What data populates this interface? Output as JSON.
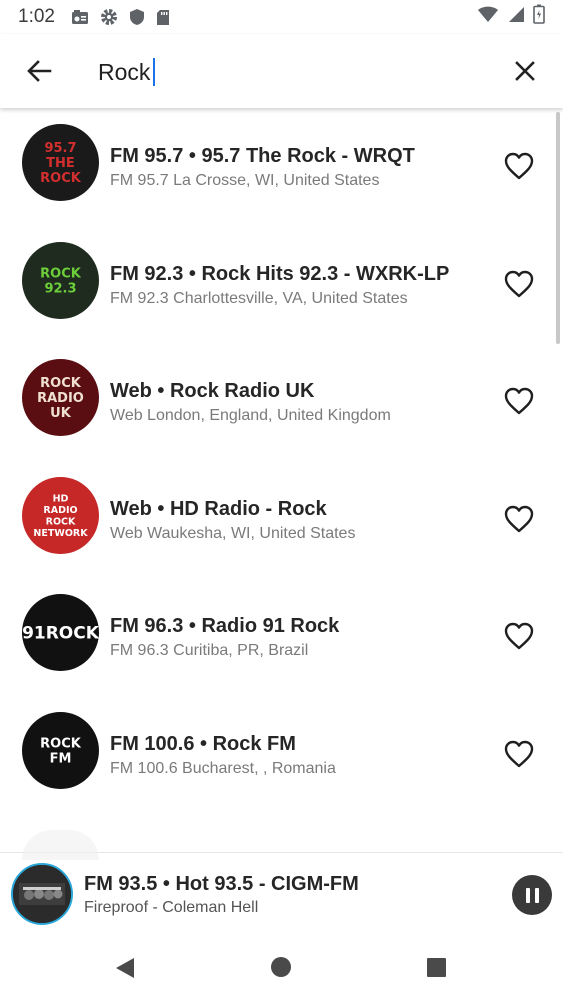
{
  "status_bar": {
    "time": "1:02",
    "icons": [
      "media-icon",
      "gear-icon",
      "shield-icon",
      "sd-card-icon"
    ],
    "right_icons": [
      "wifi-icon",
      "signal-icon",
      "battery-icon"
    ]
  },
  "search": {
    "query": "Rock",
    "back_icon": "arrow-left-icon",
    "clear_icon": "close-icon"
  },
  "results": [
    {
      "title": "FM 95.7 • 95.7 The Rock - WRQT",
      "subtitle": "FM 95.7 La Crosse, WI, United States",
      "logo_text": "95.7 THE ROCK",
      "logo_bg": "#1a1a1a",
      "logo_fg": "#d32f2f"
    },
    {
      "title": "FM 92.3 • Rock Hits 92.3 - WXRK-LP",
      "subtitle": "FM 92.3 Charlottesville, VA, United States",
      "logo_text": "ROCK 92.3",
      "logo_bg": "#1e2b1e",
      "logo_fg": "#6ccf3a"
    },
    {
      "title": "Web  • Rock Radio UK",
      "subtitle": "Web  London, England, United Kingdom",
      "logo_text": "ROCK RADIO UK",
      "logo_bg": "#5a0e12",
      "logo_fg": "#f0e0d0"
    },
    {
      "title": "Web  • HD Radio - Rock",
      "subtitle": "Web  Waukesha, WI, United States",
      "logo_text": "HD RADIO ROCK NETWORK",
      "logo_bg": "#c62828",
      "logo_fg": "#ffffff"
    },
    {
      "title": "FM 96.3 • Radio 91 Rock",
      "subtitle": "FM 96.3 Curitiba, PR, Brazil",
      "logo_text": "91ROCK",
      "logo_bg": "#111111",
      "logo_fg": "#ffffff"
    },
    {
      "title": "FM 100.6 • Rock FM",
      "subtitle": "FM 100.6 Bucharest, , Romania",
      "logo_text": "ROCK FM",
      "logo_bg": "#111111",
      "logo_fg": "#ffffff"
    }
  ],
  "now_playing": {
    "title": "FM 93.5 • Hot 93.5 - CIGM-FM",
    "subtitle": "Fireproof -  Coleman Hell"
  },
  "colors": {
    "accent": "#1a73e8",
    "text_primary": "#262626",
    "text_secondary": "#7a7a7a"
  }
}
